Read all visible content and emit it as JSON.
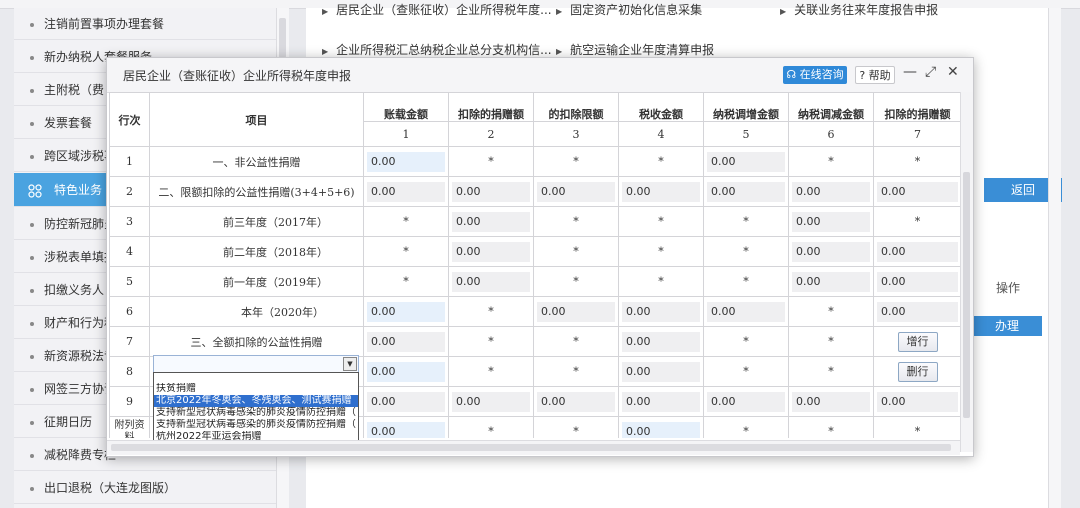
{
  "sidebar": {
    "items": [
      {
        "label": "注销前置事项办理套餐"
      },
      {
        "label": "新办纳税人套餐服务"
      },
      {
        "label": "主附税（费"
      },
      {
        "label": "发票套餐"
      },
      {
        "label": "跨区域涉税事"
      },
      {
        "label": "特色业务"
      },
      {
        "label": "防控新冠肺炎"
      },
      {
        "label": "涉税表单填报"
      },
      {
        "label": "扣缴义务人"
      },
      {
        "label": "财产和行为税"
      },
      {
        "label": "新资源税法专"
      },
      {
        "label": "网签三方协议"
      },
      {
        "label": "征期日历"
      },
      {
        "label": "减税降费专栏"
      },
      {
        "label": "出口退税（大连龙图版）"
      }
    ]
  },
  "background": {
    "links": [
      "居民企业（查账征收）企业所得税年度...",
      "固定资产初始化信息采集",
      "关联业务往来年度报告申报",
      "企业所得税汇总纳税企业总分支机构信...",
      "航空运输企业年度清算申报"
    ],
    "return_label": "返回",
    "op_label": "操作",
    "handle_label": "办理"
  },
  "modal": {
    "title": "居民企业（查账征收）企业所得税年度申报",
    "consult_label": "在线咨询",
    "help_label": "帮助",
    "col_headers": [
      "行次",
      "项目",
      "账载金额",
      "扣除的捐赠额",
      "的扣除限额",
      "税收金额",
      "纳税调增金额",
      "纳税调减金额",
      "扣除的捐赠额"
    ],
    "col_numbers": [
      "1",
      "2",
      "3",
      "4",
      "5",
      "6",
      "7"
    ],
    "rows": [
      {
        "no": "1",
        "item": "一、非公益性捐赠",
        "cells": [
          "0.00",
          "*",
          "*",
          "*",
          "0.00",
          "*",
          "*"
        ]
      },
      {
        "no": "2",
        "item": "二、限额扣除的公益性捐赠(3+4+5+6)",
        "cells": [
          "0.00",
          "0.00",
          "0.00",
          "0.00",
          "0.00",
          "0.00",
          "0.00"
        ]
      },
      {
        "no": "3",
        "item": "前三年度（2017年）",
        "cells": [
          "*",
          "0.00",
          "*",
          "*",
          "*",
          "0.00",
          "*"
        ]
      },
      {
        "no": "4",
        "item": "前二年度（2018年）",
        "cells": [
          "*",
          "0.00",
          "*",
          "*",
          "*",
          "0.00",
          "0.00"
        ]
      },
      {
        "no": "5",
        "item": "前一年度（2019年）",
        "cells": [
          "*",
          "0.00",
          "*",
          "*",
          "*",
          "0.00",
          "0.00"
        ]
      },
      {
        "no": "6",
        "item": "本年（2020年）",
        "cells": [
          "0.00",
          "*",
          "0.00",
          "0.00",
          "0.00",
          "*",
          "0.00"
        ]
      },
      {
        "no": "7",
        "item": "三、全额扣除的公益性捐赠",
        "cells": [
          "0.00",
          "*",
          "*",
          "0.00",
          "*",
          "*",
          "增行"
        ]
      },
      {
        "no": "8",
        "item": "",
        "cells": [
          "0.00",
          "*",
          "*",
          "0.00",
          "*",
          "*",
          "删行"
        ]
      },
      {
        "no": "9",
        "item": "",
        "cells": [
          "0.00",
          "0.00",
          "0.00",
          "0.00",
          "0.00",
          "0.00",
          "0.00"
        ]
      },
      {
        "no": "附列资料",
        "item": "",
        "cells": [
          "0.00",
          "*",
          "*",
          "0.00",
          "*",
          "*",
          "*"
        ]
      }
    ],
    "dropdown_options": [
      "扶贫捐赠",
      "北京2022年冬奥会、冬残奥会、测试赛捐赠",
      "支持新型冠状病毒感染的肺炎疫情防控捐赠（",
      "支持新型冠状病毒感染的肺炎疫情防控捐赠（",
      "杭州2022年亚运会捐赠"
    ]
  }
}
